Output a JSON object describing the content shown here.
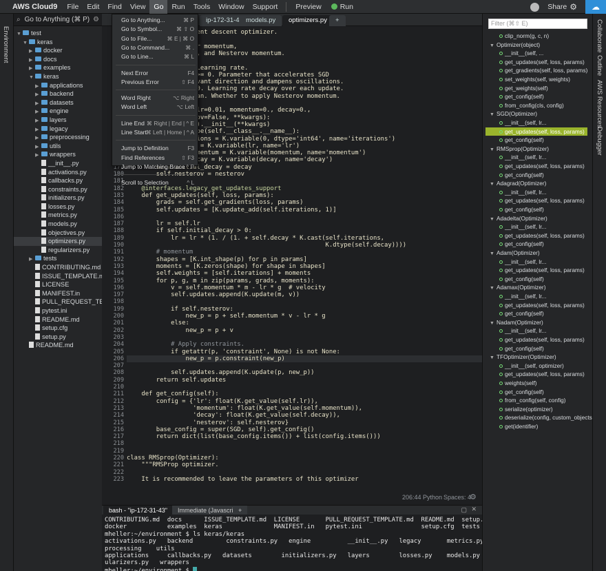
{
  "app": {
    "title": "AWS Cloud9"
  },
  "menu": [
    "File",
    "Edit",
    "Find",
    "View",
    "Go",
    "Run",
    "Tools",
    "Window",
    "Support"
  ],
  "toolbar": {
    "preview": "Preview",
    "run": "Run",
    "share": "Share"
  },
  "left_tabs": {
    "environment": "Environment"
  },
  "tree": {
    "search_label": "Go to Anything (⌘ P)",
    "rows": [
      {
        "label": "test",
        "indent": 0,
        "type": "folder",
        "open": true
      },
      {
        "label": "keras",
        "indent": 1,
        "type": "folder",
        "open": true
      },
      {
        "label": "docker",
        "indent": 2,
        "type": "folder",
        "open": false
      },
      {
        "label": "docs",
        "indent": 2,
        "type": "folder",
        "open": false
      },
      {
        "label": "examples",
        "indent": 2,
        "type": "folder",
        "open": false
      },
      {
        "label": "keras",
        "indent": 2,
        "type": "folder",
        "open": true
      },
      {
        "label": "applications",
        "indent": 3,
        "type": "folder",
        "open": false
      },
      {
        "label": "backend",
        "indent": 3,
        "type": "folder",
        "open": false
      },
      {
        "label": "datasets",
        "indent": 3,
        "type": "folder",
        "open": false
      },
      {
        "label": "engine",
        "indent": 3,
        "type": "folder",
        "open": false
      },
      {
        "label": "layers",
        "indent": 3,
        "type": "folder",
        "open": false
      },
      {
        "label": "legacy",
        "indent": 3,
        "type": "folder",
        "open": false
      },
      {
        "label": "preprocessing",
        "indent": 3,
        "type": "folder",
        "open": false
      },
      {
        "label": "utils",
        "indent": 3,
        "type": "folder",
        "open": false
      },
      {
        "label": "wrappers",
        "indent": 3,
        "type": "folder",
        "open": false
      },
      {
        "label": "__init__.py",
        "indent": 3,
        "type": "file"
      },
      {
        "label": "activations.py",
        "indent": 3,
        "type": "file"
      },
      {
        "label": "callbacks.py",
        "indent": 3,
        "type": "file"
      },
      {
        "label": "constraints.py",
        "indent": 3,
        "type": "file"
      },
      {
        "label": "initializers.py",
        "indent": 3,
        "type": "file"
      },
      {
        "label": "losses.py",
        "indent": 3,
        "type": "file"
      },
      {
        "label": "metrics.py",
        "indent": 3,
        "type": "file"
      },
      {
        "label": "models.py",
        "indent": 3,
        "type": "file"
      },
      {
        "label": "objectives.py",
        "indent": 3,
        "type": "file"
      },
      {
        "label": "optimizers.py",
        "indent": 3,
        "type": "file",
        "selected": true
      },
      {
        "label": "regularizers.py",
        "indent": 3,
        "type": "file"
      },
      {
        "label": "tests",
        "indent": 2,
        "type": "folder",
        "open": false
      },
      {
        "label": "CONTRIBUTING.md",
        "indent": 2,
        "type": "file"
      },
      {
        "label": "ISSUE_TEMPLATE.md",
        "indent": 2,
        "type": "file"
      },
      {
        "label": "LICENSE",
        "indent": 2,
        "type": "file"
      },
      {
        "label": "MANIFEST.in",
        "indent": 2,
        "type": "file"
      },
      {
        "label": "PULL_REQUEST_TEMPL",
        "indent": 2,
        "type": "file"
      },
      {
        "label": "pytest.ini",
        "indent": 2,
        "type": "file"
      },
      {
        "label": "README.md",
        "indent": 2,
        "type": "file"
      },
      {
        "label": "setup.cfg",
        "indent": 2,
        "type": "file"
      },
      {
        "label": "setup.py",
        "indent": 2,
        "type": "file"
      },
      {
        "label": "README.md",
        "indent": 1,
        "type": "file"
      }
    ]
  },
  "editor_tabs": [
    {
      "label": "ip-172-31-43"
    },
    {
      "label": "models.py"
    },
    {
      "label": "optimizers.py",
      "active": true
    },
    {
      "label": "+"
    }
  ],
  "go_menu": [
    {
      "label": "Go to Anything...",
      "key": "⌘ P"
    },
    {
      "label": "Go to Symbol...",
      "key": "⌘ ⇧ O"
    },
    {
      "label": "Go to File...",
      "key": "⌘ E | ⌘ O"
    },
    {
      "label": "Go to Command...",
      "key": "⌘ ."
    },
    {
      "label": "Go to Line...",
      "key": "⌘ L"
    },
    {
      "sep": true
    },
    {
      "label": "Next Error",
      "key": "F4"
    },
    {
      "label": "Previous Error",
      "key": "⇧ F4"
    },
    {
      "sep": true
    },
    {
      "label": "Word Right",
      "key": "⌥ Right"
    },
    {
      "label": "Word Left",
      "key": "⌥ Left"
    },
    {
      "sep": true
    },
    {
      "label": "Line End",
      "key": "⌘ Right | End | ^ E"
    },
    {
      "label": "Line Start",
      "key": "⌘ Left | Home | ^ A"
    },
    {
      "sep": true
    },
    {
      "label": "Jump to Definition",
      "key": "F3"
    },
    {
      "label": "Find References",
      "key": "⇧ F3"
    },
    {
      "label": "Jump to Matching Brace",
      "key": "^ P"
    },
    {
      "sep": true
    },
    {
      "label": "Scroll to Selection",
      "key": "^ L"
    }
  ],
  "code_lines": [
    {
      "n": "",
      "t": "                   ent descent optimizer."
    },
    {
      "n": "",
      "t": ""
    },
    {
      "n": "",
      "t": "                   r momentum,"
    },
    {
      "n": "",
      "t": "                   , and Nesterov momentum."
    },
    {
      "n": "",
      "t": ""
    },
    {
      "n": "",
      "t": "                   Learning rate."
    },
    {
      "n": "",
      "t": "                   >= 0. Parameter that accelerates SGD"
    },
    {
      "n": "",
      "t": "                   vant direction and dampens oscillations."
    },
    {
      "n": "",
      "t": "                   0. Learning rate decay over each update."
    },
    {
      "n": "",
      "t": "                   an. Whether to apply Nesterov momentum."
    },
    {
      "n": "",
      "t": ""
    },
    {
      "n": "",
      "t": "                   lr=0.01, momentum=0., decay=0.,"
    },
    {
      "n": "",
      "t": "                   ov=False, **kwargs):"
    },
    {
      "n": "",
      "t": "                   ).__init__(**kwargs)"
    },
    {
      "n": "",
      "t": "                   pe(self.__class__.__name__):"
    },
    {
      "n": "",
      "t": "                   ions = K.variable(0, dtype='int64', name='iterations')"
    },
    {
      "n": "176",
      "t": "            self.lr = K.variable(lr, name='lr')"
    },
    {
      "n": "177",
      "t": "            self.momentum = K.variable(momentum, name='momentum')"
    },
    {
      "n": "178",
      "t": "            self.decay = K.variable(decay, name='decay')"
    },
    {
      "n": "179",
      "t": "        self.initial_decay = decay"
    },
    {
      "n": "180",
      "t": "        self.nesterov = nesterov"
    },
    {
      "n": "181",
      "t": ""
    },
    {
      "n": "182",
      "t": "    @interfaces.legacy_get_updates_support"
    },
    {
      "n": "183",
      "t": "    def get_updates(self, loss, params):"
    },
    {
      "n": "184",
      "t": "        grads = self.get_gradients(loss, params)"
    },
    {
      "n": "185",
      "t": "        self.updates = [K.update_add(self.iterations, 1)]"
    },
    {
      "n": "186",
      "t": ""
    },
    {
      "n": "187",
      "t": "        lr = self.lr"
    },
    {
      "n": "188",
      "t": "        if self.initial_decay > 0:"
    },
    {
      "n": "189",
      "t": "            lr = lr * (1. / (1. + self.decay * K.cast(self.iterations,"
    },
    {
      "n": "190",
      "t": "                                                      K.dtype(self.decay))))"
    },
    {
      "n": "191",
      "t": "        # momentum"
    },
    {
      "n": "192",
      "t": "        shapes = [K.int_shape(p) for p in params]"
    },
    {
      "n": "193",
      "t": "        moments = [K.zeros(shape) for shape in shapes]"
    },
    {
      "n": "194",
      "t": "        self.weights = [self.iterations] + moments"
    },
    {
      "n": "195",
      "t": "        for p, g, m in zip(params, grads, moments):"
    },
    {
      "n": "196",
      "t": "            v = self.momentum * m - lr * g  # velocity"
    },
    {
      "n": "197",
      "t": "            self.updates.append(K.update(m, v))"
    },
    {
      "n": "198",
      "t": ""
    },
    {
      "n": "199",
      "t": "            if self.nesterov:"
    },
    {
      "n": "200",
      "t": "                new_p = p + self.momentum * v - lr * g"
    },
    {
      "n": "201",
      "t": "            else:"
    },
    {
      "n": "202",
      "t": "                new_p = p + v"
    },
    {
      "n": "203",
      "t": ""
    },
    {
      "n": "204",
      "t": "            # Apply constraints."
    },
    {
      "n": "205",
      "t": "            if getattr(p, 'constraint', None) is not None:"
    },
    {
      "n": "206",
      "t": "                new_p = p.constraint(new_p)",
      "hl": true
    },
    {
      "n": "207",
      "t": ""
    },
    {
      "n": "208",
      "t": "            self.updates.append(K.update(p, new_p))"
    },
    {
      "n": "209",
      "t": "        return self.updates"
    },
    {
      "n": "210",
      "t": ""
    },
    {
      "n": "211",
      "t": "    def get_config(self):"
    },
    {
      "n": "212",
      "t": "        config = {'lr': float(K.get_value(self.lr)),"
    },
    {
      "n": "213",
      "t": "                  'momentum': float(K.get_value(self.momentum)),"
    },
    {
      "n": "214",
      "t": "                  'decay': float(K.get_value(self.decay)),"
    },
    {
      "n": "215",
      "t": "                  'nesterov': self.nesterov}"
    },
    {
      "n": "216",
      "t": "        base_config = super(SGD, self).get_config()"
    },
    {
      "n": "217",
      "t": "        return dict(list(base_config.items()) + list(config.items()))"
    },
    {
      "n": "218",
      "t": ""
    },
    {
      "n": "219",
      "t": ""
    },
    {
      "n": "220",
      "t": "class RMSprop(Optimizer):"
    },
    {
      "n": "221",
      "t": "    \"\"\"RMSProp optimizer."
    },
    {
      "n": "222",
      "t": ""
    },
    {
      "n": "223",
      "t": "    It is recommended to leave the parameters of this optimizer"
    }
  ],
  "status": {
    "position": "206:44",
    "language": "Python",
    "spaces": "Spaces: 4"
  },
  "outline": {
    "filter_placeholder": "Filter (⌘⇧ E)",
    "rows": [
      {
        "label": "clip_norm(g, c, n)",
        "indent": 1,
        "kind": "fn"
      },
      {
        "label": "Optimizer(object)",
        "indent": 0,
        "kind": "class"
      },
      {
        "label": "__init__(self, ...",
        "indent": 1,
        "kind": "fn"
      },
      {
        "label": "get_updates(self, loss, params)",
        "indent": 1,
        "kind": "fn"
      },
      {
        "label": "get_gradients(self, loss, params)",
        "indent": 1,
        "kind": "fn"
      },
      {
        "label": "set_weights(self, weights)",
        "indent": 1,
        "kind": "fn"
      },
      {
        "label": "get_weights(self)",
        "indent": 1,
        "kind": "fn"
      },
      {
        "label": "get_config(self)",
        "indent": 1,
        "kind": "fn"
      },
      {
        "label": "from_config(cls, config)",
        "indent": 1,
        "kind": "fn"
      },
      {
        "label": "SGD(Optimizer)",
        "indent": 0,
        "kind": "class"
      },
      {
        "label": "__init__(self, lr...",
        "indent": 1,
        "kind": "fn"
      },
      {
        "label": "get_updates(self, loss, params)",
        "indent": 1,
        "kind": "fn",
        "selected": true
      },
      {
        "label": "get_config(self)",
        "indent": 1,
        "kind": "fn"
      },
      {
        "label": "RMSprop(Optimizer)",
        "indent": 0,
        "kind": "class"
      },
      {
        "label": "__init__(self, lr...",
        "indent": 1,
        "kind": "fn"
      },
      {
        "label": "get_updates(self, loss, params)",
        "indent": 1,
        "kind": "fn"
      },
      {
        "label": "get_config(self)",
        "indent": 1,
        "kind": "fn"
      },
      {
        "label": "Adagrad(Optimizer)",
        "indent": 0,
        "kind": "class"
      },
      {
        "label": "__init__(self, lr...",
        "indent": 1,
        "kind": "fn"
      },
      {
        "label": "get_updates(self, loss, params)",
        "indent": 1,
        "kind": "fn"
      },
      {
        "label": "get_config(self)",
        "indent": 1,
        "kind": "fn"
      },
      {
        "label": "Adadelta(Optimizer)",
        "indent": 0,
        "kind": "class"
      },
      {
        "label": "__init__(self, lr...",
        "indent": 1,
        "kind": "fn"
      },
      {
        "label": "get_updates(self, loss, params)",
        "indent": 1,
        "kind": "fn"
      },
      {
        "label": "get_config(self)",
        "indent": 1,
        "kind": "fn"
      },
      {
        "label": "Adam(Optimizer)",
        "indent": 0,
        "kind": "class"
      },
      {
        "label": "__init__(self, lr...",
        "indent": 1,
        "kind": "fn"
      },
      {
        "label": "get_updates(self, loss, params)",
        "indent": 1,
        "kind": "fn"
      },
      {
        "label": "get_config(self)",
        "indent": 1,
        "kind": "fn"
      },
      {
        "label": "Adamax(Optimizer)",
        "indent": 0,
        "kind": "class"
      },
      {
        "label": "__init__(self, lr...",
        "indent": 1,
        "kind": "fn"
      },
      {
        "label": "get_updates(self, loss, params)",
        "indent": 1,
        "kind": "fn"
      },
      {
        "label": "get_config(self)",
        "indent": 1,
        "kind": "fn"
      },
      {
        "label": "Nadam(Optimizer)",
        "indent": 0,
        "kind": "class"
      },
      {
        "label": "__init__(self, lr...",
        "indent": 1,
        "kind": "fn"
      },
      {
        "label": "get_updates(self, loss, params)",
        "indent": 1,
        "kind": "fn"
      },
      {
        "label": "get_config(self)",
        "indent": 1,
        "kind": "fn"
      },
      {
        "label": "TFOptimizer(Optimizer)",
        "indent": 0,
        "kind": "class"
      },
      {
        "label": "__init__(self, optimizer)",
        "indent": 1,
        "kind": "fn"
      },
      {
        "label": "get_updates(self, loss, params)",
        "indent": 1,
        "kind": "fn"
      },
      {
        "label": "weights(self)",
        "indent": 1,
        "kind": "fn"
      },
      {
        "label": "get_config(self)",
        "indent": 1,
        "kind": "fn"
      },
      {
        "label": "from_config(self, config)",
        "indent": 1,
        "kind": "fn"
      },
      {
        "label": "serialize(optimizer)",
        "indent": 1,
        "kind": "fn"
      },
      {
        "label": "deserialize(config, custom_objects...",
        "indent": 1,
        "kind": "fn"
      },
      {
        "label": "get(identifier)",
        "indent": 1,
        "kind": "fn"
      }
    ]
  },
  "right_tabs": [
    "Collaborate",
    "Outline",
    "AWS Resources",
    "Debugger"
  ],
  "terminal": {
    "tabs": [
      {
        "label": "bash - \"ip-172-31-43\"",
        "active": true
      },
      {
        "label": "Immediate (Javascri"
      },
      {
        "label": "+"
      }
    ],
    "lines": [
      "CONTRIBUTING.md  docs      ISSUE_TEMPLATE.md  LICENSE       PULL_REQUEST_TEMPLATE.md  README.md  setup.py",
      "docker           examples  keras              MANIFEST.in   pytest.ini                setup.cfg  tests",
      "mheller:~/environment $ ls keras/keras",
      "activations.py   backend         constraints.py   engine          __init__.py   legacy       metrics.py   objectives.py   pre",
      "processing    utils",
      "applications     callbacks.py   datasets        initializers.py   layers        losses.py    models.py    optimizers.py   reg",
      "ularizers.py   wrappers",
      "mheller:~/environment $ "
    ]
  },
  "colors": {
    "accent": "#2f8fd8",
    "selection": "#9ab42c",
    "background": "#1e1f21"
  }
}
